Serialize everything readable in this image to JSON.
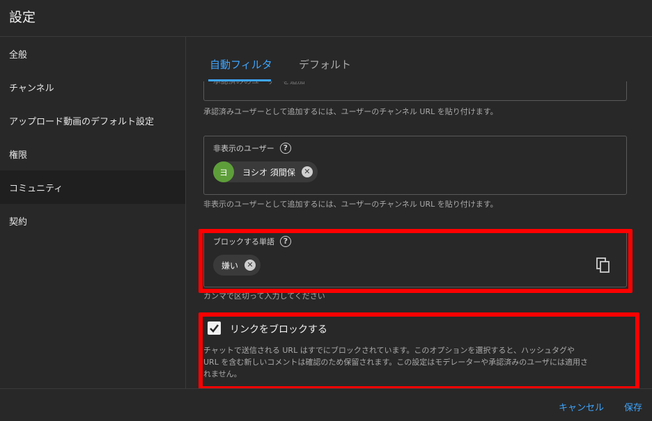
{
  "header": {
    "title": "設定"
  },
  "sidebar": {
    "items": [
      {
        "label": "全般"
      },
      {
        "label": "チャンネル"
      },
      {
        "label": "アップロード動画のデフォルト設定"
      },
      {
        "label": "権限"
      },
      {
        "label": "コミュニティ",
        "active": true
      },
      {
        "label": "契約"
      }
    ]
  },
  "tabs": [
    {
      "label": "自動フィルタ",
      "active": true
    },
    {
      "label": "デフォルト"
    }
  ],
  "approved_users": {
    "partial_placeholder": "承認済みのユーザーを追加",
    "help": "承認済みユーザーとして追加するには、ユーザーのチャンネル URL を貼り付けます。"
  },
  "hidden_users": {
    "label": "非表示のユーザー",
    "chip": {
      "avatar_letter": "ヨ",
      "name": "ヨシオ 須間保"
    },
    "help": "非表示のユーザーとして追加するには、ユーザーのチャンネル URL を貼り付けます。"
  },
  "blocked_words": {
    "label": "ブロックする単語",
    "chip": {
      "text": "嫌い"
    },
    "help": "カンマで区切って入力してください"
  },
  "block_links": {
    "checked": true,
    "label": "リンクをブロックする",
    "help_line1": "チャットで送信される URL はすでにブロックされています。このオプションを選択すると、ハッシュタグや",
    "help_line2": "URL を含む新しいコメントは確認のため保留されます。この設定はモデレーターや承認済みのユーザには適用さ",
    "help_line3": "れません。"
  },
  "footer": {
    "cancel": "キャンセル",
    "save": "保存"
  },
  "colors": {
    "accent": "#3ea6ff",
    "highlight": "#ff0000",
    "avatar": "#5e9e3a"
  }
}
